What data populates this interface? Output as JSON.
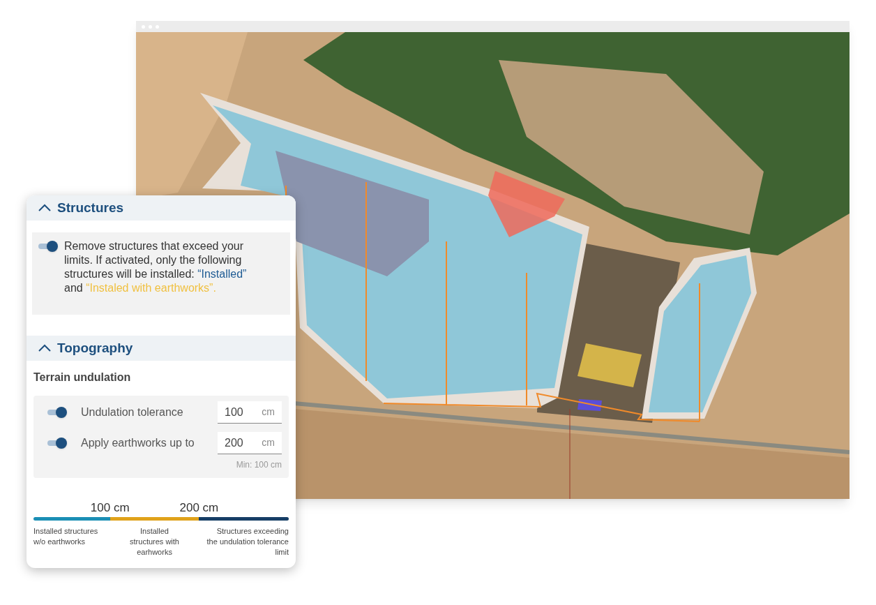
{
  "structures": {
    "title": "Structures",
    "expanded": true,
    "remove_toggle": {
      "on": true,
      "parts": [
        {
          "kind": "plain",
          "text": "Remove structures that exceed your limits. If activated, only the following structures will be installed: "
        },
        {
          "kind": "installed",
          "text": "“Installed”"
        },
        {
          "kind": "plain",
          "text": " and "
        },
        {
          "kind": "earthworks",
          "text": "“Instaled with earthworks”."
        }
      ]
    }
  },
  "topography": {
    "title": "Topography",
    "expanded": true,
    "subtitle": "Terrain undulation",
    "settings": [
      {
        "label": "Undulation tolerance",
        "on": true,
        "value": "100",
        "unit": "cm"
      },
      {
        "label": "Apply earthworks up to",
        "on": true,
        "value": "200",
        "unit": "cm",
        "hint": "Min: 100 cm"
      }
    ],
    "scale": {
      "ticks": [
        "100 cm",
        "200 cm"
      ],
      "segments": [
        {
          "label": "Installed structures w/o earthworks",
          "color": "#1b8fb5"
        },
        {
          "label": "Installed structures with earhworks",
          "color": "#e0a21a"
        },
        {
          "label": "Structures exceeding the undulation tolerance limit",
          "color": "#163e66"
        }
      ]
    }
  }
}
